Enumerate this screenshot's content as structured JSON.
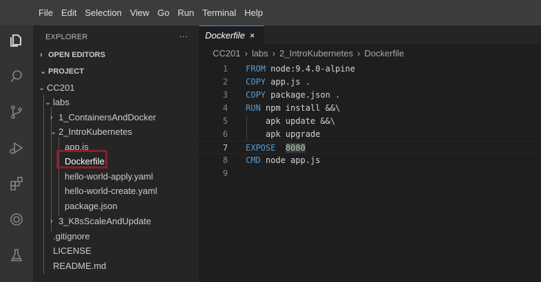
{
  "menu": [
    "File",
    "Edit",
    "Selection",
    "View",
    "Go",
    "Run",
    "Terminal",
    "Help"
  ],
  "activity_icons": [
    "explorer-icon",
    "search-icon",
    "source-control-icon",
    "run-debug-icon",
    "extensions-icon",
    "remote-icon",
    "testing-icon"
  ],
  "sidebar": {
    "header": "EXPLORER",
    "more": "···",
    "open_editors": "OPEN EDITORS",
    "project": "PROJECT",
    "tree": [
      {
        "label": "CC201",
        "chev": "⌄"
      },
      {
        "label": "labs",
        "chev": "⌄"
      },
      {
        "label": "1_ContainersAndDocker",
        "chev": "›"
      },
      {
        "label": "2_IntroKubernetes",
        "chev": "⌄"
      },
      {
        "label": "app.js"
      },
      {
        "label": "Dockerfile"
      },
      {
        "label": "hello-world-apply.yaml"
      },
      {
        "label": "hello-world-create.yaml"
      },
      {
        "label": "package.json"
      },
      {
        "label": "3_K8sScaleAndUpdate",
        "chev": "›"
      },
      {
        "label": ".gitignore"
      },
      {
        "label": "LICENSE"
      },
      {
        "label": "README.md"
      }
    ]
  },
  "editor": {
    "tab_label": "Dockerfile",
    "tab_close": "×",
    "breadcrumb": [
      "CC201",
      "labs",
      "2_IntroKubernetes",
      "Dockerfile"
    ],
    "breadcrumb_sep": "›",
    "lines": [
      {
        "n": "1",
        "kw": "FROM",
        "rest": " node:9.4.0-alpine"
      },
      {
        "n": "2",
        "kw": "COPY",
        "rest": " app.js ."
      },
      {
        "n": "3",
        "kw": "COPY",
        "rest": " package.json ."
      },
      {
        "n": "4",
        "kw": "RUN",
        "rest": " npm install &&\\"
      },
      {
        "n": "5",
        "kw": "",
        "rest": "    apk update &&\\"
      },
      {
        "n": "6",
        "kw": "",
        "rest": "    apk upgrade"
      },
      {
        "n": "7",
        "kw": "EXPOSE",
        "rest": "8080"
      },
      {
        "n": "8",
        "kw": "CMD",
        "rest": " node app.js"
      },
      {
        "n": "9",
        "kw": "",
        "rest": ""
      }
    ]
  },
  "colors": {
    "keyword": "#569cd6",
    "selection_box": "#8b1e2b",
    "tab_accent": "#3794ff"
  }
}
